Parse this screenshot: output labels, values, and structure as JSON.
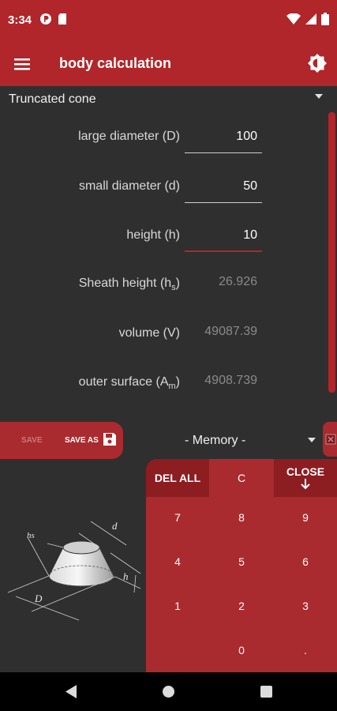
{
  "status_bar": {
    "time": "3:34"
  },
  "app_bar": {
    "title": "body calculation"
  },
  "shape": {
    "selected": "Truncated cone"
  },
  "fields": [
    {
      "label": "large diameter (D)",
      "value": "100"
    },
    {
      "label": "small diameter (d)",
      "value": "50"
    },
    {
      "label": "height (h)",
      "value": "10"
    },
    {
      "label_main": "Sheath height (h",
      "label_sub": "s",
      "label_end": ")",
      "value": "26.926"
    },
    {
      "label": "volume (V)",
      "value": "49087.39"
    },
    {
      "label_main": "outer surface (A",
      "label_sub": "m",
      "label_end": ")",
      "value": "4908.739"
    }
  ],
  "save_panel": {
    "save_label": "SAVE",
    "save_as_label": "SAVE AS"
  },
  "memory": {
    "selected": "- Memory -"
  },
  "keypad": {
    "del_all": "DEL ALL",
    "clear": "C",
    "close": "CLOSE",
    "keys": [
      "7",
      "8",
      "9",
      "4",
      "5",
      "6",
      "1",
      "2",
      "3",
      "0",
      "."
    ]
  },
  "diagram_labels": {
    "D": "D",
    "d": "d",
    "h": "h",
    "hs": "hs"
  },
  "colors": {
    "primary": "#b0262a",
    "keypad": "#a92b2f",
    "keypad_dark": "#8c1d21",
    "background": "#2f2f2f"
  }
}
